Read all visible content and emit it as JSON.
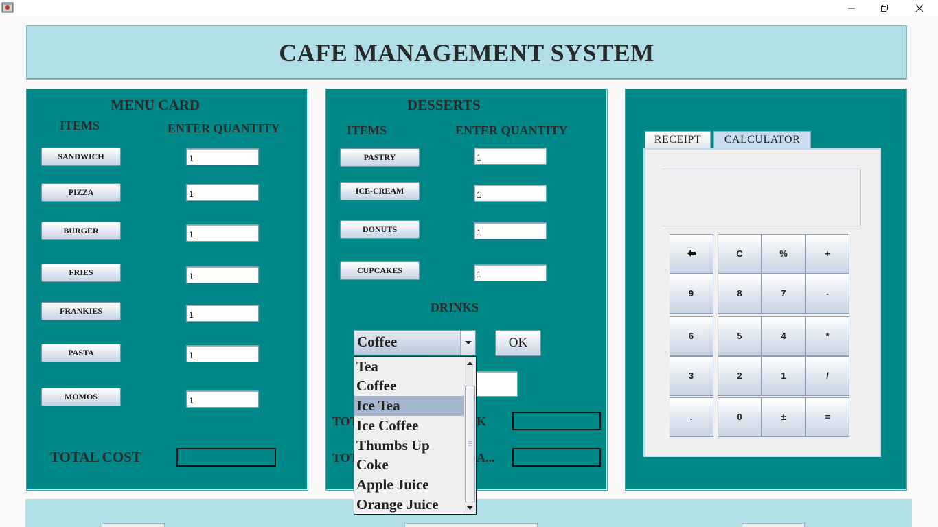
{
  "window": {
    "icon": "java-app-icon",
    "controls": [
      "minimize-icon",
      "maximize-icon",
      "close-icon"
    ]
  },
  "header": {
    "title": "CAFE MANAGEMENT SYSTEM"
  },
  "menu_card": {
    "title": "MENU CARD",
    "col_items": "ITEMS",
    "col_qty": "ENTER QUANTITY",
    "items": [
      {
        "label": "SANDWICH",
        "qty": "1"
      },
      {
        "label": "PIZZA",
        "qty": "1"
      },
      {
        "label": "BURGER",
        "qty": "1"
      },
      {
        "label": "FRIES",
        "qty": "1"
      },
      {
        "label": "FRANKIES",
        "qty": "1"
      },
      {
        "label": "PASTA",
        "qty": "1"
      },
      {
        "label": "MOMOS",
        "qty": "1"
      }
    ],
    "total_label": "TOTAL COST",
    "total_value": ""
  },
  "desserts": {
    "title": "DESSERTS",
    "col_items": "ITEMS",
    "col_qty": "ENTER QUANTITY",
    "items": [
      {
        "label": "PASTRY",
        "qty": "1"
      },
      {
        "label": "ICE-CREAM",
        "qty": "1"
      },
      {
        "label": "DONUTS",
        "qty": "1"
      },
      {
        "label": "CUPCAKES",
        "qty": "1"
      }
    ],
    "drinks_title": "DRINKS",
    "drink_selected": "Coffee",
    "ok_label": "OK",
    "drink_qty": "",
    "total1_left": "TOT",
    "total1_right": "K",
    "total1_value": "",
    "total2_left": "TOT",
    "total2_right": "A...",
    "total2_value": ""
  },
  "drink_options": [
    "Tea",
    "Coffee",
    "Ice Tea",
    "Ice Coffee",
    "Thumbs Up",
    "Coke",
    "Apple Juice",
    "Orange Juice"
  ],
  "drink_highlighted": "Ice Tea",
  "tabs": {
    "receipt": "RECEIPT",
    "calculator": "CALCULATOR",
    "active": "CALCULATOR"
  },
  "calculator": {
    "display": "",
    "keys": [
      [
        "←",
        "C",
        "%",
        "+"
      ],
      [
        "9",
        "8",
        "7",
        "-"
      ],
      [
        "6",
        "5",
        "4",
        "*"
      ],
      [
        "3",
        "2",
        "1",
        "/"
      ],
      [
        ".",
        "0",
        "±",
        "="
      ]
    ]
  },
  "colors": {
    "panel": "#008787",
    "header": "#b0e0e6",
    "highlight": "#a4b5cd"
  }
}
